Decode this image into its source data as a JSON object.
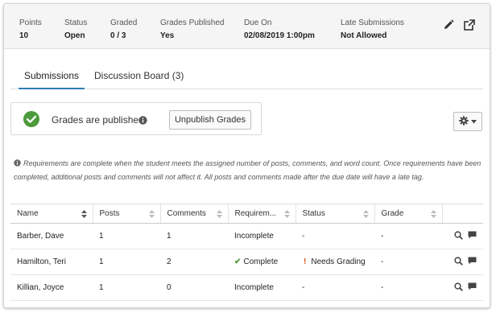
{
  "meta": [
    {
      "label": "Points",
      "value": "10"
    },
    {
      "label": "Status",
      "value": "Open"
    },
    {
      "label": "Graded",
      "value": "0 / 3"
    },
    {
      "label": "Grades Published",
      "value": "Yes"
    },
    {
      "label": "Due On",
      "value": "02/08/2019 1:00pm"
    },
    {
      "label": "Late Submissions",
      "value": "Not Allowed"
    }
  ],
  "header_actions": {
    "edit_icon": "pencil-icon",
    "open_icon": "external-link-icon"
  },
  "tabs": [
    {
      "label": "Submissions",
      "active": true
    },
    {
      "label": "Discussion Board (3)",
      "active": false
    }
  ],
  "publish": {
    "status_text": "Grades are published",
    "button_label": "Unpublish Grades",
    "icon": "check-circle-icon",
    "accent": "#4c9a3b"
  },
  "settings_icon": "gear-icon",
  "note": "Requirements are complete when the student meets the assigned number of posts, comments, and word count. Once requirements have been completed, additional posts and comments will not affect it. All posts and comments made after the due date will have a late tag.",
  "table": {
    "columns": [
      "Name",
      "Posts",
      "Comments",
      "Requirem...",
      "Status",
      "Grade",
      ""
    ],
    "rows": [
      {
        "name": "Barber, Dave",
        "posts": "1",
        "comments": "1",
        "requirements": "Incomplete",
        "req_complete": false,
        "status": "-",
        "needs_grading": false,
        "grade": "-"
      },
      {
        "name": "Hamilton, Teri",
        "posts": "1",
        "comments": "2",
        "requirements": "Complete",
        "req_complete": true,
        "status": "Needs Grading",
        "needs_grading": true,
        "grade": "-"
      },
      {
        "name": "Killian, Joyce",
        "posts": "1",
        "comments": "0",
        "requirements": "Incomplete",
        "req_complete": false,
        "status": "-",
        "needs_grading": false,
        "grade": "-"
      }
    ]
  },
  "colors": {
    "tab_underline": "#2d7db4",
    "complete_check": "#4c9a3b",
    "needs_grading": "#d9531e"
  }
}
